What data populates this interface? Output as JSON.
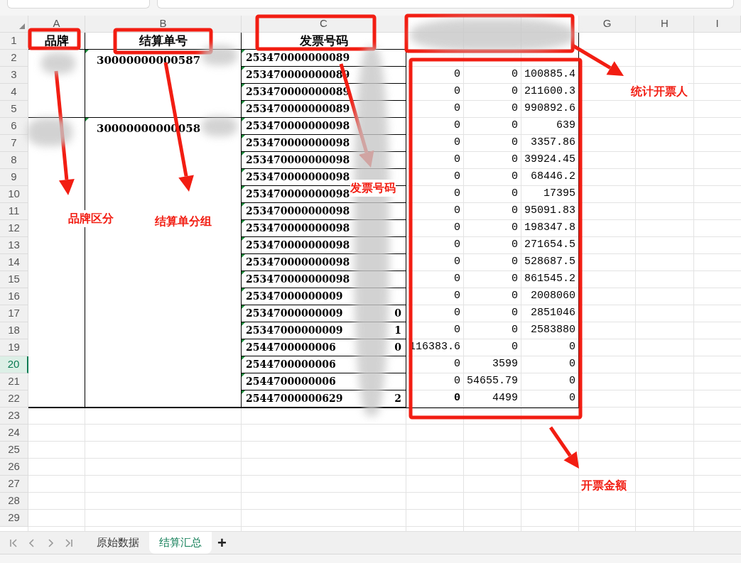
{
  "column_headers": [
    {
      "label": "A",
      "selected": false
    },
    {
      "label": "B",
      "selected": false
    },
    {
      "label": "C",
      "selected": false
    },
    {
      "label": "G",
      "selected": false
    },
    {
      "label": "H",
      "selected": false
    },
    {
      "label": "I",
      "selected": false
    }
  ],
  "row_numbers": [
    {
      "label": "1",
      "selected": false
    },
    {
      "label": "2",
      "selected": false
    },
    {
      "label": "3",
      "selected": false
    },
    {
      "label": "4",
      "selected": false
    },
    {
      "label": "5",
      "selected": false
    },
    {
      "label": "6",
      "selected": false
    },
    {
      "label": "7",
      "selected": false
    },
    {
      "label": "8",
      "selected": false
    },
    {
      "label": "9",
      "selected": false
    },
    {
      "label": "10",
      "selected": false
    },
    {
      "label": "11",
      "selected": false
    },
    {
      "label": "12",
      "selected": false
    },
    {
      "label": "13",
      "selected": false
    },
    {
      "label": "14",
      "selected": false
    },
    {
      "label": "15",
      "selected": false
    },
    {
      "label": "16",
      "selected": false
    },
    {
      "label": "17",
      "selected": false
    },
    {
      "label": "18",
      "selected": false
    },
    {
      "label": "19",
      "selected": false
    },
    {
      "label": "20",
      "selected": true
    },
    {
      "label": "21",
      "selected": false
    },
    {
      "label": "22",
      "selected": false
    },
    {
      "label": "23",
      "selected": false
    },
    {
      "label": "24",
      "selected": false
    },
    {
      "label": "25",
      "selected": false
    },
    {
      "label": "26",
      "selected": false
    },
    {
      "label": "27",
      "selected": false
    },
    {
      "label": "28",
      "selected": false
    },
    {
      "label": "29",
      "selected": false
    }
  ],
  "header": {
    "brand": "品牌",
    "settlement_no": "结算单号",
    "invoice_no": "发票号码"
  },
  "groups": [
    {
      "settlement_no": "30000000000587",
      "invoices": [
        {
          "invoice_no": "253470000000089"
        },
        {
          "invoice_no": "253470000000089",
          "column_4": "0",
          "column_5": "0",
          "column_6": "100885.4"
        },
        {
          "invoice_no": "253470000000089",
          "column_4": "0",
          "column_5": "0",
          "column_6": "211600.3"
        },
        {
          "invoice_no": "253470000000089",
          "column_4": "0",
          "column_5": "0",
          "column_6": "990892.6"
        }
      ]
    },
    {
      "settlement_no": "30000000000058",
      "invoices": [
        {
          "invoice_no": "253470000000098",
          "column_4": "0",
          "column_5": "0",
          "column_6": "639"
        },
        {
          "invoice_no": "253470000000098",
          "column_4": "0",
          "column_5": "0",
          "column_6": "3357.86"
        },
        {
          "invoice_no": "253470000000098",
          "column_4": "0",
          "column_5": "0",
          "column_6": "39924.45"
        },
        {
          "invoice_no": "253470000000098",
          "column_4": "0",
          "column_5": "0",
          "column_6": "68446.2"
        },
        {
          "invoice_no": "253470000000098",
          "column_4": "0",
          "column_5": "0",
          "column_6": "17395"
        },
        {
          "invoice_no": "253470000000098",
          "column_4": "0",
          "column_5": "0",
          "column_6": "95091.83"
        },
        {
          "invoice_no": "253470000000098",
          "column_4": "0",
          "column_5": "0",
          "column_6": "198347.8"
        },
        {
          "invoice_no": "253470000000098",
          "column_4": "0",
          "column_5": "0",
          "column_6": "271654.5"
        },
        {
          "invoice_no": "253470000000098",
          "column_4": "0",
          "column_5": "0",
          "column_6": "528687.5"
        },
        {
          "invoice_no": "253470000000098",
          "column_4": "0",
          "column_5": "0",
          "column_6": "861545.2"
        },
        {
          "invoice_no": "25347000000009",
          "column_4": "0",
          "column_5": "0",
          "column_6": "2008060"
        },
        {
          "invoice_no": "25347000000009",
          "tail": "0",
          "column_4": "0",
          "column_5": "0",
          "column_6": "2851046"
        },
        {
          "invoice_no": "25347000000009",
          "tail": "1",
          "column_4": "0",
          "column_5": "0",
          "column_6": "2583880"
        },
        {
          "invoice_no": "2544700000006",
          "tail": "0",
          "column_4": "116383.6",
          "column_5": "0",
          "column_6": "0"
        },
        {
          "invoice_no": "2544700000006",
          "column_4": "0",
          "column_5": "3599",
          "column_6": "0"
        },
        {
          "invoice_no": "2544700000006",
          "column_4": "0",
          "column_5": "54655.79",
          "column_6": "0"
        },
        {
          "invoice_no": "25447000000629",
          "tail": "2",
          "column_4": "0",
          "column_4_bold": true,
          "column_5": "4499",
          "column_6": "0"
        }
      ]
    }
  ],
  "annotations": [
    {
      "label": "品牌区分"
    },
    {
      "label": "结算单分组"
    },
    {
      "label": "发票号码"
    },
    {
      "label": "统计开票人"
    },
    {
      "label": "开票金额"
    }
  ],
  "sheet_tabs": [
    {
      "label": "原始数据",
      "selected": false
    },
    {
      "label": "结算汇总",
      "selected": true
    }
  ],
  "add_tab": "+"
}
